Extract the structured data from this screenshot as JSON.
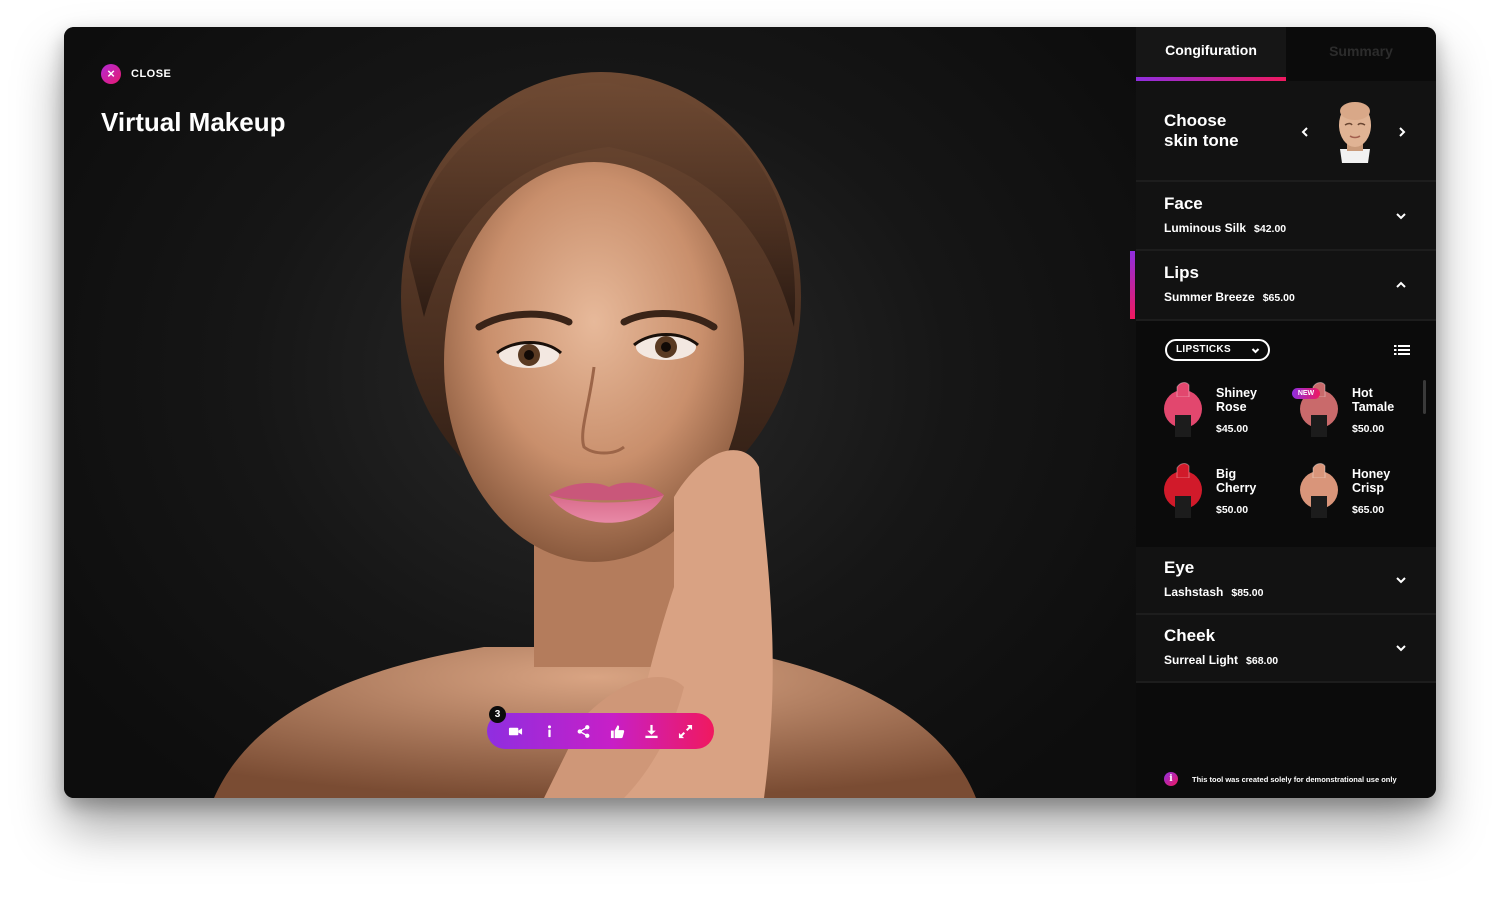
{
  "header": {
    "close_label": "CLOSE",
    "title": "Virtual Makeup"
  },
  "toolbar": {
    "badge_count": "3",
    "buttons": [
      "camera-icon",
      "info-icon",
      "share-icon",
      "thumbs-up-icon",
      "download-icon",
      "expand-icon"
    ]
  },
  "tabs": [
    {
      "label": "Congifuration",
      "active": true
    },
    {
      "label": "Summary",
      "active": false
    }
  ],
  "skin_tone": {
    "title_line1": "Choose",
    "title_line2": "skin tone"
  },
  "sections": {
    "face": {
      "title": "Face",
      "product": "Luminous Silk",
      "price": "$42.00",
      "expanded": false
    },
    "lips": {
      "title": "Lips",
      "product": "Summer Breeze",
      "price": "$65.00",
      "expanded": true
    },
    "eye": {
      "title": "Eye",
      "product": "Lashstash",
      "price": "$85.00",
      "expanded": false
    },
    "cheek": {
      "title": "Cheek",
      "product": "Surreal Light",
      "price": "$68.00",
      "expanded": false
    }
  },
  "lips_panel": {
    "category": "LIPSTICKS",
    "products": [
      {
        "name_line1": "Shiney",
        "name_line2": "Rose",
        "price": "$45.00",
        "color": "#e2476e",
        "is_new": false
      },
      {
        "name_line1": "Hot",
        "name_line2": "Tamale",
        "price": "$50.00",
        "color": "#c96a6b",
        "is_new": true,
        "badge": "NEW"
      },
      {
        "name_line1": "Big",
        "name_line2": "Cherry",
        "price": "$50.00",
        "color": "#d11a2a",
        "is_new": false
      },
      {
        "name_line1": "Honey",
        "name_line2": "Crisp",
        "price": "$65.00",
        "color": "#d9957a",
        "is_new": false
      }
    ]
  },
  "footer": {
    "info_symbol": "i",
    "note": "This tool was created solely for demonstrational use only"
  },
  "colors": {
    "accent_start": "#8f2ee0",
    "accent_end": "#f0195f",
    "background": "#0e0e0e",
    "panel": "#0b0b0b"
  }
}
